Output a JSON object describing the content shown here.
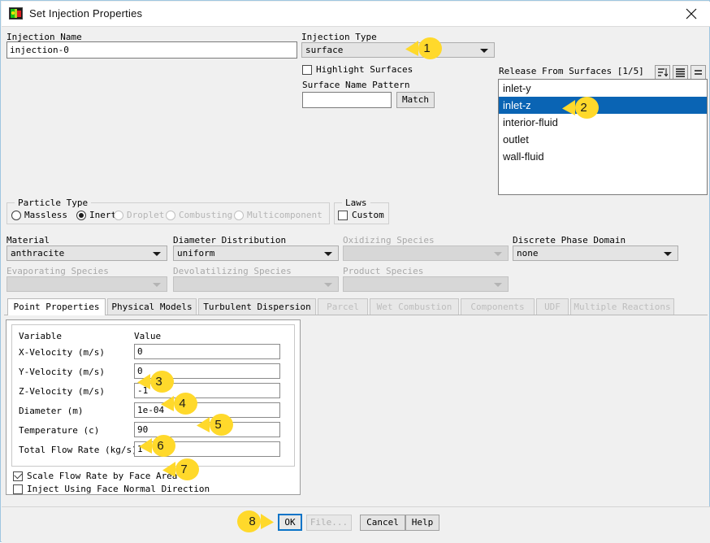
{
  "window": {
    "title": "Set Injection Properties",
    "icon": "fluent-app-icon",
    "close_icon": "close-icon"
  },
  "injection": {
    "name_label": "Injection Name",
    "name_value": "injection-0",
    "type_label": "Injection Type",
    "type_value": "surface",
    "highlight_surfaces_label": "Highlight Surfaces",
    "highlight_surfaces_checked": false,
    "surface_name_pattern_label": "Surface Name Pattern",
    "surface_name_pattern_value": "",
    "match_button": "Match"
  },
  "release_from_surfaces": {
    "label": "Release From Surfaces [1/5]",
    "items": [
      {
        "label": "inlet-y",
        "selected": false
      },
      {
        "label": "inlet-z",
        "selected": true
      },
      {
        "label": "interior-fluid",
        "selected": false
      },
      {
        "label": "outlet",
        "selected": false
      },
      {
        "label": "wall-fluid",
        "selected": false
      }
    ],
    "tool_buttons": [
      {
        "name": "list-sort-icon"
      },
      {
        "name": "list-all-icon"
      },
      {
        "name": "list-equal-icon"
      }
    ]
  },
  "particle_type": {
    "group_label": "Particle Type",
    "options": [
      {
        "label": "Massless",
        "selected": false,
        "enabled": true
      },
      {
        "label": "Inert",
        "selected": true,
        "enabled": true
      },
      {
        "label": "Droplet",
        "selected": false,
        "enabled": false
      },
      {
        "label": "Combusting",
        "selected": false,
        "enabled": false
      },
      {
        "label": "Multicomponent",
        "selected": false,
        "enabled": false
      }
    ]
  },
  "laws": {
    "group_label": "Laws",
    "custom_label": "Custom",
    "custom_checked": false
  },
  "selectors": {
    "material_label": "Material",
    "material_value": "anthracite",
    "material_enabled": true,
    "diameter_distribution_label": "Diameter Distribution",
    "diameter_distribution_value": "uniform",
    "diameter_distribution_enabled": true,
    "oxidizing_species_label": "Oxidizing Species",
    "oxidizing_species_value": "",
    "oxidizing_species_enabled": false,
    "discrete_phase_domain_label": "Discrete Phase Domain",
    "discrete_phase_domain_value": "none",
    "discrete_phase_domain_enabled": true,
    "evaporating_species_label": "Evaporating Species",
    "evaporating_species_value": "",
    "evaporating_species_enabled": false,
    "devolatilizing_species_label": "Devolatilizing Species",
    "devolatilizing_species_value": "",
    "devolatilizing_species_enabled": false,
    "product_species_label": "Product Species",
    "product_species_value": "",
    "product_species_enabled": false
  },
  "tabs": [
    {
      "label": "Point Properties",
      "active": true,
      "enabled": true
    },
    {
      "label": "Physical Models",
      "active": false,
      "enabled": true
    },
    {
      "label": "Turbulent Dispersion",
      "active": false,
      "enabled": true
    },
    {
      "label": "Parcel",
      "active": false,
      "enabled": false
    },
    {
      "label": "Wet Combustion",
      "active": false,
      "enabled": false
    },
    {
      "label": "Components",
      "active": false,
      "enabled": false
    },
    {
      "label": "UDF",
      "active": false,
      "enabled": false
    },
    {
      "label": "Multiple Reactions",
      "active": false,
      "enabled": false
    }
  ],
  "point_properties": {
    "col_variable": "Variable",
    "col_value": "Value",
    "rows": [
      {
        "variable": "X-Velocity (m/s)",
        "value": "0"
      },
      {
        "variable": "Y-Velocity (m/s)",
        "value": "0"
      },
      {
        "variable": "Z-Velocity (m/s)",
        "value": "-1"
      },
      {
        "variable": "Diameter (m)",
        "value": "1e-04"
      },
      {
        "variable": "Temperature (c)",
        "value": "90"
      },
      {
        "variable": "Total Flow Rate (kg/s)",
        "value": "1"
      }
    ],
    "scale_flow_rate_label": "Scale Flow Rate by Face Area",
    "scale_flow_rate_checked": true,
    "inject_face_normal_label": "Inject Using Face Normal Direction",
    "inject_face_normal_checked": false
  },
  "buttons": {
    "ok": "OK",
    "file": "File...",
    "file_enabled": false,
    "cancel": "Cancel",
    "help": "Help"
  },
  "callouts": [
    {
      "number": "1",
      "target": "injection-type-combo",
      "direction": "left"
    },
    {
      "number": "2",
      "target": "release-surface-inlet-z",
      "direction": "left"
    },
    {
      "number": "3",
      "target": "z-velocity-input",
      "direction": "left"
    },
    {
      "number": "4",
      "target": "diameter-input",
      "direction": "left"
    },
    {
      "number": "5",
      "target": "temperature-input",
      "direction": "left"
    },
    {
      "number": "6",
      "target": "total-flow-rate-input",
      "direction": "left"
    },
    {
      "number": "7",
      "target": "scale-flow-rate-checkbox",
      "direction": "left"
    },
    {
      "number": "8",
      "target": "ok-button",
      "direction": "right"
    }
  ],
  "colors": {
    "accent": "#0a64b4",
    "badge": "#ffd92b",
    "default_button_border": "#0a74c8"
  }
}
